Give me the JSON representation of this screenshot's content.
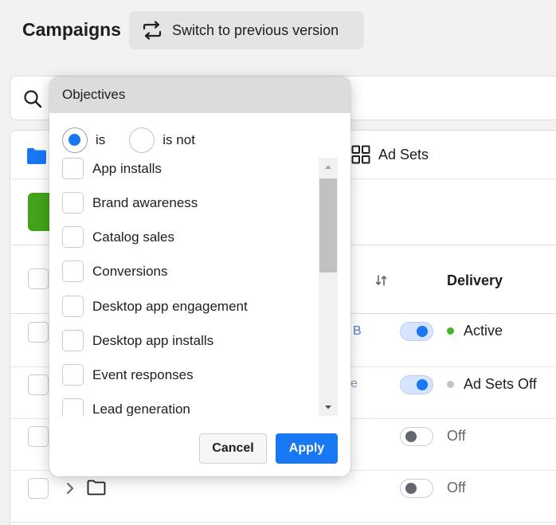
{
  "header": {
    "title": "Campaigns",
    "switch_label": "Switch to previous version"
  },
  "tabs": {
    "adsets_label": "Ad Sets"
  },
  "table": {
    "delivery_header": "Delivery",
    "rows": [
      {
        "snippet": "B",
        "toggle": "on",
        "status": "Active",
        "status_color": "#42b72a"
      },
      {
        "snippet": "e",
        "toggle": "on",
        "status": "Ad Sets Off",
        "status_color": "#bec3c9"
      },
      {
        "snippet": "",
        "toggle": "off",
        "status": "Off"
      },
      {
        "snippet": "",
        "toggle": "off",
        "status": "Off"
      }
    ]
  },
  "popover": {
    "title": "Objectives",
    "radio_is": "is",
    "radio_is_not": "is not",
    "options": [
      "App installs",
      "Brand awareness",
      "Catalog sales",
      "Conversions",
      "Desktop app engagement",
      "Desktop app installs",
      "Event responses",
      "Lead generation"
    ],
    "cancel_label": "Cancel",
    "apply_label": "Apply"
  },
  "colors": {
    "primary": "#1877f2",
    "create_green": "#42a319"
  }
}
